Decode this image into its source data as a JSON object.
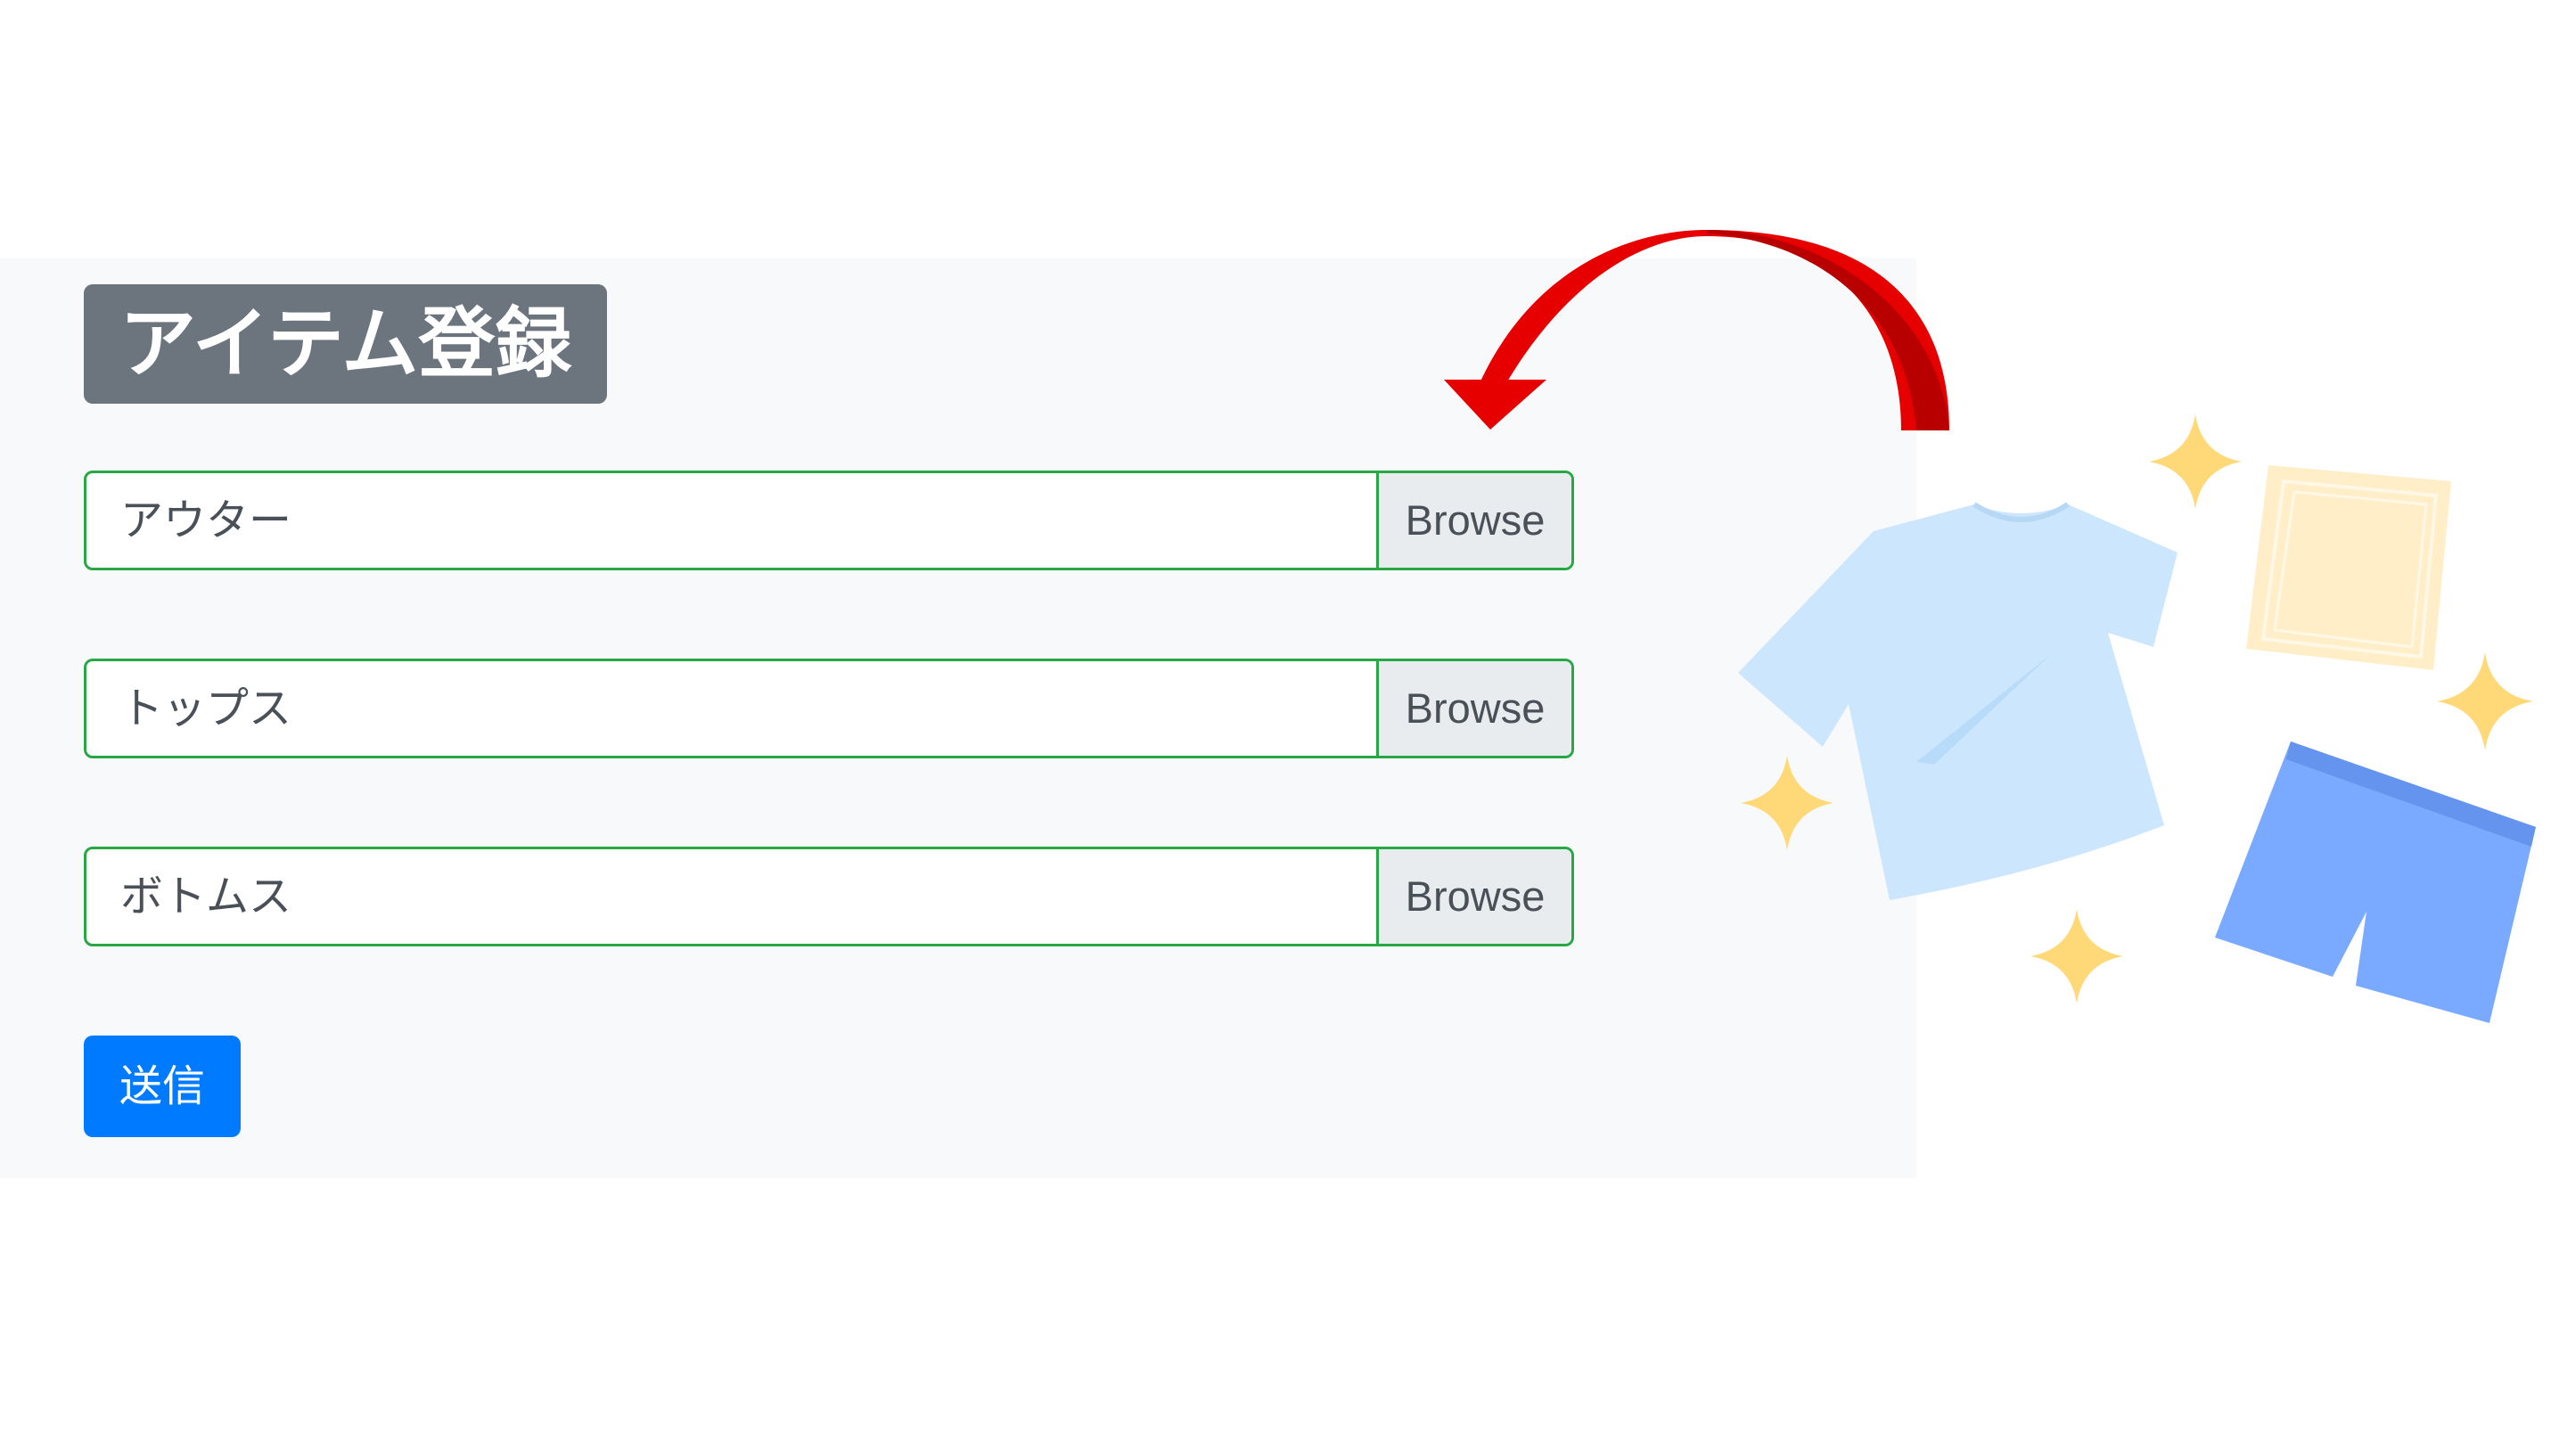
{
  "form": {
    "title": "アイテム登録",
    "fields": [
      {
        "label": "アウター",
        "button": "Browse"
      },
      {
        "label": "トップス",
        "button": "Browse"
      },
      {
        "label": "ボトムス",
        "button": "Browse"
      }
    ],
    "submit_label": "送信"
  },
  "colors": {
    "panel_bg": "#f8f9fa",
    "title_badge": "#6c757d",
    "field_border": "#28a745",
    "browse_bg": "#e9ecef",
    "submit_bg": "#007bff",
    "arrow": "#e60000",
    "shirt": "#cbe6fd",
    "shorts": "#7aaaff",
    "towel": "#ffeec8",
    "sparkle": "#ffd877"
  },
  "icons": [
    "curved-arrow-icon",
    "tshirt-icon",
    "shorts-icon",
    "towel-icon",
    "sparkle-icon"
  ]
}
